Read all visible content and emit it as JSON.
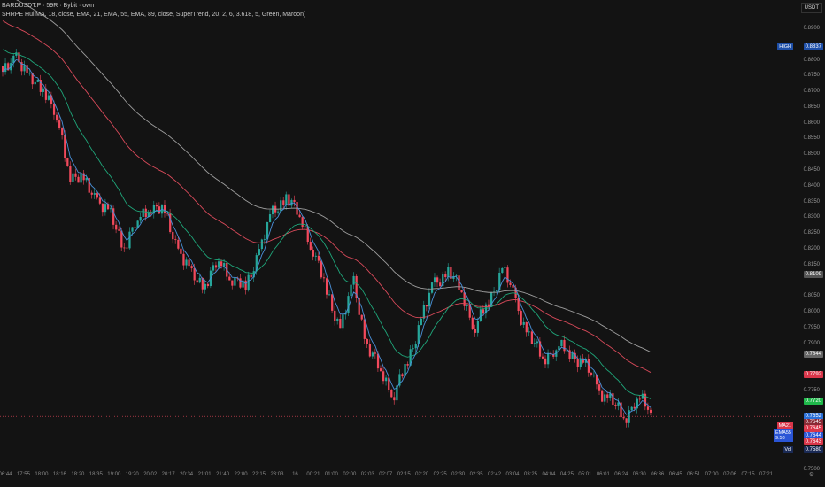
{
  "legend": {
    "symbol": "BARDUSDT.P · 59R · Bybit · own",
    "indicators": "SHRPE HullMA, 18, close, EMA, 21, EMA, 55, EMA, 89, close, SuperTrend, 20, 2, 6, 3.618, 5, Green, Maroon)"
  },
  "currency": "USDT",
  "colors": {
    "up": "#26a69a",
    "down": "#f2495c",
    "ema21": "#1fa67a",
    "ema55": "#d94a5a",
    "ema89": "#9e9e9e",
    "hma": "#4a90d9",
    "last": "#f2495c"
  },
  "price_scale": {
    "ticks": [
      "0.8900",
      "0.8800",
      "0.8750",
      "0.8700",
      "0.8650",
      "0.8600",
      "0.8550",
      "0.8500",
      "0.8450",
      "0.8400",
      "0.8350",
      "0.8300",
      "0.8250",
      "0.8200",
      "0.8150",
      "0.8050",
      "0.8000",
      "0.7950",
      "0.7900",
      "0.7800",
      "0.7750",
      "0.7500"
    ],
    "badges": [
      {
        "label": "HIGH",
        "value": "0.8837",
        "color": "#1e4fa8",
        "p": 0.8841
      },
      {
        "value": "0.8109",
        "color": "#555",
        "p": 0.8118
      },
      {
        "value": "0.7844",
        "color": "#666",
        "p": 0.7865
      },
      {
        "value": "0.7792",
        "color": "#d9364a",
        "p": 0.7801
      },
      {
        "value": "0.7720",
        "color": "#1fb84a",
        "p": 0.7716
      },
      {
        "value": "0.7652",
        "color": "#2a6fd6",
        "p": 0.7668
      },
      {
        "value": "0.7645",
        "color": "#8a2a35",
        "p": 0.7648
      },
      {
        "label": "MA21 9:58",
        "value": "0.7645",
        "color": "#d9364a",
        "p": 0.7628
      },
      {
        "label": "EMA55 9:58",
        "value": "0.7644",
        "color": "#2a55d6",
        "p": 0.7608
      },
      {
        "value": "0.7643",
        "color": "#d9364a",
        "p": 0.7588
      },
      {
        "label": "Vol",
        "value": "0.7580",
        "color": "#1a2a55",
        "p": 0.7563
      }
    ]
  },
  "times": [
    "06:44",
    "17:55",
    "18:00",
    "18:16",
    "18:20",
    "18:35",
    "19:00",
    "19:20",
    "20:02",
    "20:17",
    "20:34",
    "21:01",
    "21:40",
    "22:00",
    "22:15",
    "23:03",
    "16",
    "00:21",
    "01:00",
    "02:00",
    "02:03",
    "02:07",
    "02:15",
    "02:20",
    "02:25",
    "02:30",
    "02:35",
    "02:42",
    "03:04",
    "03:25",
    "04:04",
    "04:25",
    "05:01",
    "06:01",
    "06:24",
    "06:30",
    "06:36",
    "06:45",
    "06:51",
    "07:00",
    "07:06",
    "07:15",
    "07:21"
  ],
  "chart_data": {
    "type": "candlestick",
    "last_price": 0.7668,
    "ylim": [
      0.745,
      0.899
    ],
    "keypoints": [
      0.875,
      0.882,
      0.873,
      0.872,
      0.861,
      0.844,
      0.841,
      0.836,
      0.83,
      0.821,
      0.829,
      0.834,
      0.831,
      0.82,
      0.811,
      0.809,
      0.816,
      0.811,
      0.807,
      0.82,
      0.831,
      0.837,
      0.83,
      0.82,
      0.806,
      0.795,
      0.809,
      0.789,
      0.781,
      0.774,
      0.784,
      0.798,
      0.809,
      0.813,
      0.806,
      0.795,
      0.803,
      0.814,
      0.803,
      0.792,
      0.785,
      0.789,
      0.787,
      0.784,
      0.776,
      0.772,
      0.766,
      0.773,
      0.768
    ],
    "ema_seed": {
      "ema21": 0.884,
      "ema55": 0.893,
      "ema89": 0.902
    }
  }
}
